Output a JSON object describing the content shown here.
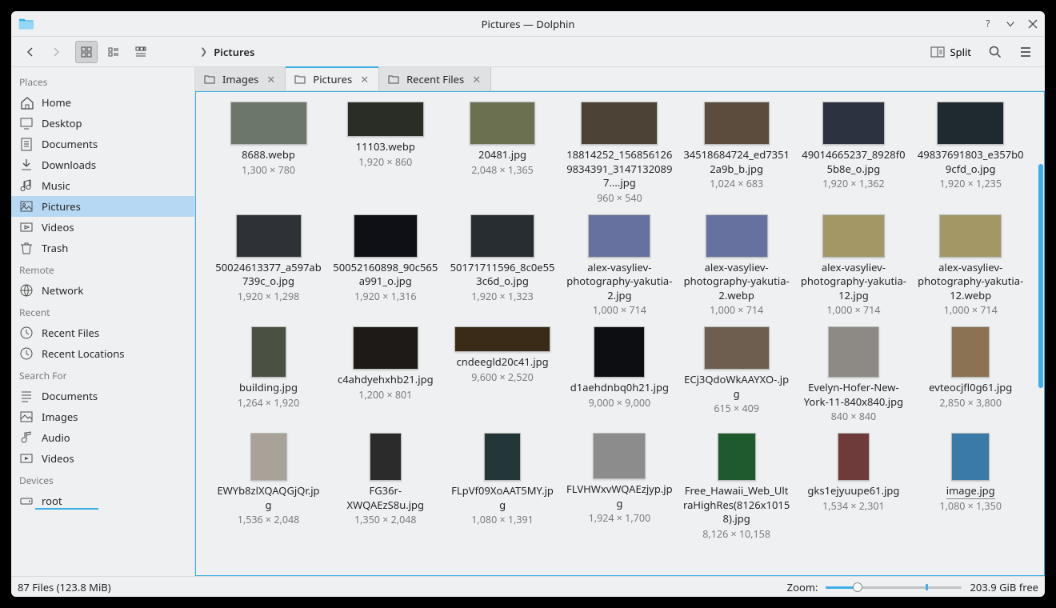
{
  "window": {
    "title": "Pictures — Dolphin"
  },
  "toolbar": {
    "split_label": "Split"
  },
  "breadcrumb": {
    "current": "Pictures"
  },
  "tabs": [
    {
      "label": "Images",
      "active": false
    },
    {
      "label": "Pictures",
      "active": true
    },
    {
      "label": "Recent Files",
      "active": false
    }
  ],
  "sidebar": {
    "sections": [
      {
        "header": "Places",
        "items": [
          {
            "icon": "home",
            "label": "Home"
          },
          {
            "icon": "desktop",
            "label": "Desktop"
          },
          {
            "icon": "folder-docs",
            "label": "Documents"
          },
          {
            "icon": "download",
            "label": "Downloads"
          },
          {
            "icon": "music",
            "label": "Music"
          },
          {
            "icon": "pictures",
            "label": "Pictures",
            "active": true
          },
          {
            "icon": "videos",
            "label": "Videos"
          },
          {
            "icon": "trash",
            "label": "Trash"
          }
        ]
      },
      {
        "header": "Remote",
        "items": [
          {
            "icon": "network",
            "label": "Network"
          }
        ]
      },
      {
        "header": "Recent",
        "items": [
          {
            "icon": "clock",
            "label": "Recent Files"
          },
          {
            "icon": "clock",
            "label": "Recent Locations"
          }
        ]
      },
      {
        "header": "Search For",
        "items": [
          {
            "icon": "search-docs",
            "label": "Documents"
          },
          {
            "icon": "search-images",
            "label": "Images"
          },
          {
            "icon": "search-audio",
            "label": "Audio"
          },
          {
            "icon": "search-videos",
            "label": "Videos"
          }
        ]
      },
      {
        "header": "Devices",
        "items": [
          {
            "icon": "drive",
            "label": "root",
            "usage_bar": true
          }
        ]
      }
    ]
  },
  "files": [
    {
      "name": "8688.webp",
      "dims": "1,300 × 780",
      "tw": 96,
      "th": 54,
      "bg": "#6d766a"
    },
    {
      "name": "11103.webp",
      "dims": "1,920 × 860",
      "tw": 96,
      "th": 44,
      "bg": "#2a2d26"
    },
    {
      "name": "20481.jpg",
      "dims": "2,048 × 1,365",
      "tw": 82,
      "th": 54,
      "bg": "#6a7050"
    },
    {
      "name": "18814252_1568561269834391_31471320897....jpg",
      "dims": "960 × 540",
      "tw": 96,
      "th": 54,
      "bg": "#4c4236"
    },
    {
      "name": "34518684724_ed73512a9b_b.jpg",
      "dims": "1,024 × 683",
      "tw": 82,
      "th": 54,
      "bg": "#5b4c3e"
    },
    {
      "name": "49014665237_8928f05b8e_o.jpg",
      "dims": "1,920 × 1,362",
      "tw": 78,
      "th": 54,
      "bg": "#2d3240"
    },
    {
      "name": "49837691803_e357b09cfd_o.jpg",
      "dims": "1,920 × 1,235",
      "tw": 84,
      "th": 54,
      "bg": "#1e2a30"
    },
    {
      "name": "50024613377_a597ab739c_o.jpg",
      "dims": "1,920 × 1,298",
      "tw": 82,
      "th": 54,
      "bg": "#2e3237"
    },
    {
      "name": "50052160898_90c565a991_o.jpg",
      "dims": "1,920 × 1,316",
      "tw": 80,
      "th": 54,
      "bg": "#0e1016"
    },
    {
      "name": "50171711596_8c0e553c6d_o.jpg",
      "dims": "1,920 × 1,323",
      "tw": 80,
      "th": 54,
      "bg": "#272d31"
    },
    {
      "name": "alex-vasyliev-photography-yakutia-2.jpg",
      "dims": "1,000 × 714",
      "tw": 78,
      "th": 54,
      "bg": "#6671a0"
    },
    {
      "name": "alex-vasyliev-photography-yakutia-2.webp",
      "dims": "1,000 × 714",
      "tw": 78,
      "th": 54,
      "bg": "#6671a0"
    },
    {
      "name": "alex-vasyliev-photography-yakutia-12.jpg",
      "dims": "1,000 × 714",
      "tw": 78,
      "th": 54,
      "bg": "#a39766"
    },
    {
      "name": "alex-vasyliev-photography-yakutia-12.webp",
      "dims": "1,000 × 714",
      "tw": 78,
      "th": 54,
      "bg": "#a39766"
    },
    {
      "name": "building.jpg",
      "dims": "1,264 × 1,920",
      "tw": 44,
      "th": 64,
      "bg": "#4a5042"
    },
    {
      "name": "c4ahdyehxhb21.jpg",
      "dims": "1,200 × 801",
      "tw": 82,
      "th": 54,
      "bg": "#1e1a18"
    },
    {
      "name": "cndeegld20c41.jpg",
      "dims": "9,600 × 2,520",
      "tw": 120,
      "th": 32,
      "bg": "#3a2a18"
    },
    {
      "name": "d1aehdnbq0h21.jpg",
      "dims": "9,000 × 9,000",
      "tw": 64,
      "th": 64,
      "bg": "#0d0e12"
    },
    {
      "name": "ECj3QdoWkAAYXO-.jpg",
      "dims": "615 × 409",
      "tw": 82,
      "th": 54,
      "bg": "#6e5e4f"
    },
    {
      "name": "Evelyn-Hofer-New-York-11-840x840.jpg",
      "dims": "840 × 840",
      "tw": 64,
      "th": 64,
      "bg": "#8d8984"
    },
    {
      "name": "evteocjfl0g61.jpg",
      "dims": "2,850 × 3,800",
      "tw": 48,
      "th": 64,
      "bg": "#8a7252"
    },
    {
      "name": "EWYb8zlXQAQGjQr.jpg",
      "dims": "1,536 × 2,048",
      "tw": 46,
      "th": 60,
      "bg": "#a9a298"
    },
    {
      "name": "FG36r-XWQAEzS8u.jpg",
      "dims": "1,350 × 2,048",
      "tw": 40,
      "th": 60,
      "bg": "#2b2b2b"
    },
    {
      "name": "FLpVf09XoAAT5MY.jpg",
      "dims": "1,080 × 1,391",
      "tw": 46,
      "th": 60,
      "bg": "#233638"
    },
    {
      "name": "FLVHWxvWQAEzjyp.jpg",
      "dims": "1,924 × 1,700",
      "tw": 66,
      "th": 58,
      "bg": "#8c8c8c"
    },
    {
      "name": "Free_Hawaii_Web_UltraHighRes(8126x10158).jpg",
      "dims": "8,126 × 10,158",
      "tw": 48,
      "th": 60,
      "bg": "#1e5a2e"
    },
    {
      "name": "gks1ejyuupe61.jpg",
      "dims": "1,534 × 2,301",
      "tw": 40,
      "th": 60,
      "bg": "#6e3a3a"
    },
    {
      "name": "image.jpg",
      "dims": "1,080 × 1,350",
      "tw": 48,
      "th": 60,
      "bg": "#3a7aa8",
      "selected_underline": true
    }
  ],
  "status": {
    "summary": "87 Files (123.8 MiB)",
    "zoom_label": "Zoom:",
    "free_space": "203.9 GiB free"
  }
}
